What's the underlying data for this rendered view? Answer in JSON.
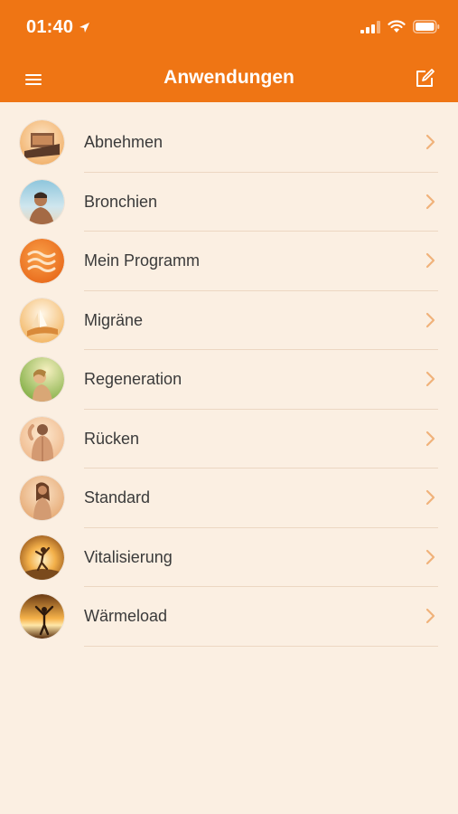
{
  "status_bar": {
    "time": "01:40"
  },
  "nav": {
    "title": "Anwendungen"
  },
  "items": [
    {
      "label": "Abnehmen",
      "icon": "abnehmen-avatar-icon"
    },
    {
      "label": "Bronchien",
      "icon": "bronchien-avatar-icon"
    },
    {
      "label": "Mein Programm",
      "icon": "mein-programm-avatar-icon"
    },
    {
      "label": "Migräne",
      "icon": "migraene-avatar-icon"
    },
    {
      "label": "Regeneration",
      "icon": "regeneration-avatar-icon"
    },
    {
      "label": "Rücken",
      "icon": "ruecken-avatar-icon"
    },
    {
      "label": "Standard",
      "icon": "standard-avatar-icon"
    },
    {
      "label": "Vitalisierung",
      "icon": "vitalisierung-avatar-icon"
    },
    {
      "label": "Wärmeload",
      "icon": "waermeload-avatar-icon"
    }
  ],
  "colors": {
    "header": "#ef7514",
    "background": "#fbefe2",
    "divider": "#ecd7c2",
    "chevron": "#f0b27a"
  }
}
